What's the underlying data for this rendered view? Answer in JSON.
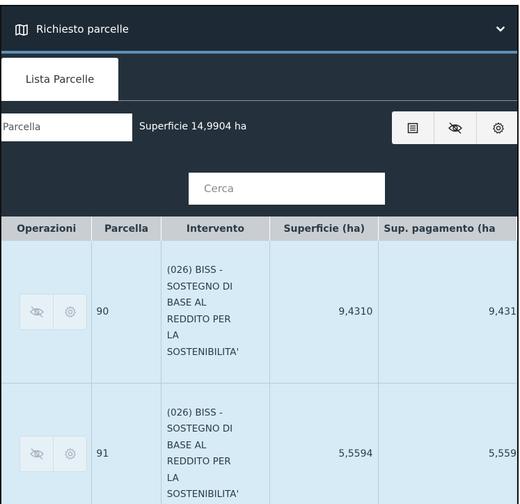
{
  "header": {
    "title": "Richiesto parcelle"
  },
  "tabs": [
    {
      "label": "Lista Parcelle"
    }
  ],
  "toolbar": {
    "parcel_placeholder": "Parcella",
    "surface_text": "Superficie 14,9904 ha"
  },
  "search": {
    "placeholder": "Cerca"
  },
  "table": {
    "columns": [
      "Operazioni",
      "Parcella",
      "Intervento",
      "Superficie (ha)",
      "Sup. pagamento (ha"
    ],
    "rows": [
      {
        "parcella": "90",
        "intervento": [
          "(026) BISS -",
          "SOSTEGNO DI",
          "BASE AL",
          "REDDITO PER",
          "LA",
          "SOSTENIBILITA'"
        ],
        "superficie": "9,4310",
        "pagamento": "9,431"
      },
      {
        "parcella": "91",
        "intervento": [
          "(026) BISS -",
          "SOSTEGNO DI",
          "BASE AL",
          "REDDITO PER",
          "LA",
          "SOSTENIBILITA'"
        ],
        "superficie": "5,5594",
        "pagamento": "5,559"
      }
    ]
  }
}
